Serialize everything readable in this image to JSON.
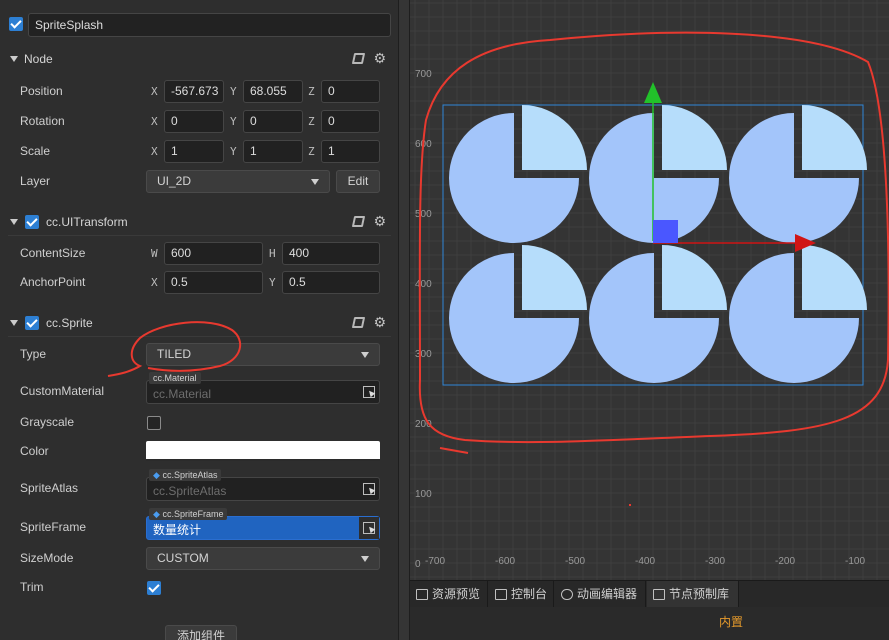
{
  "node_name": "SpriteSplash",
  "sections": {
    "node": "Node",
    "transform": "cc.UITransform",
    "sprite": "cc.Sprite"
  },
  "node": {
    "position": {
      "label": "Position",
      "x": "-567.673",
      "y": "68.055",
      "z": "0"
    },
    "rotation": {
      "label": "Rotation",
      "x": "0",
      "y": "0",
      "z": "0"
    },
    "scale": {
      "label": "Scale",
      "x": "1",
      "y": "1",
      "z": "1"
    },
    "layer": {
      "label": "Layer",
      "value": "UI_2D",
      "edit": "Edit"
    }
  },
  "transform": {
    "content_size": {
      "label": "ContentSize",
      "w": "600",
      "h": "400"
    },
    "anchor_point": {
      "label": "AnchorPoint",
      "x": "0.5",
      "y": "0.5"
    }
  },
  "axes": {
    "x": "X",
    "y": "Y",
    "z": "Z",
    "w": "W",
    "h": "H"
  },
  "sprite": {
    "type": {
      "label": "Type",
      "value": "TILED"
    },
    "custom_material": {
      "label": "CustomMaterial",
      "tag": "cc.Material",
      "placeholder": "cc.Material"
    },
    "grayscale": {
      "label": "Grayscale",
      "checked": false
    },
    "color": {
      "label": "Color",
      "value": "#ffffff"
    },
    "sprite_atlas": {
      "label": "SpriteAtlas",
      "tag": "cc.SpriteAtlas",
      "placeholder": "cc.SpriteAtlas"
    },
    "sprite_frame": {
      "label": "SpriteFrame",
      "tag": "cc.SpriteFrame",
      "value": "数量统计"
    },
    "size_mode": {
      "label": "SizeMode",
      "value": "CUSTOM"
    },
    "trim": {
      "label": "Trim",
      "checked": true
    }
  },
  "add_component": "添加组件",
  "scene": {
    "y_ticks": [
      "700",
      "600",
      "500",
      "400",
      "300",
      "200",
      "100",
      "0"
    ],
    "x_ticks": [
      "-700",
      "-600",
      "-500",
      "-400",
      "-300",
      "-200",
      "-100"
    ],
    "colors": {
      "background": "#343434",
      "grid": "#3e3e3e",
      "selection": "#2f86d8",
      "tile_base": "#a3c5fa",
      "tile_quarter": "#b6ddfb",
      "annotation": "#e8392f",
      "gizmo_y": "#22c12a",
      "gizmo_x": "#d01515",
      "gizmo_center": "#4a57ff"
    }
  },
  "tabs": [
    {
      "label": "资源预览",
      "icon": "asset-preview-icon"
    },
    {
      "label": "控制台",
      "icon": "console-icon"
    },
    {
      "label": "动画编辑器",
      "icon": "animation-icon"
    },
    {
      "label": "节点预制库",
      "icon": "prefab-library-icon"
    }
  ],
  "status": "内置"
}
